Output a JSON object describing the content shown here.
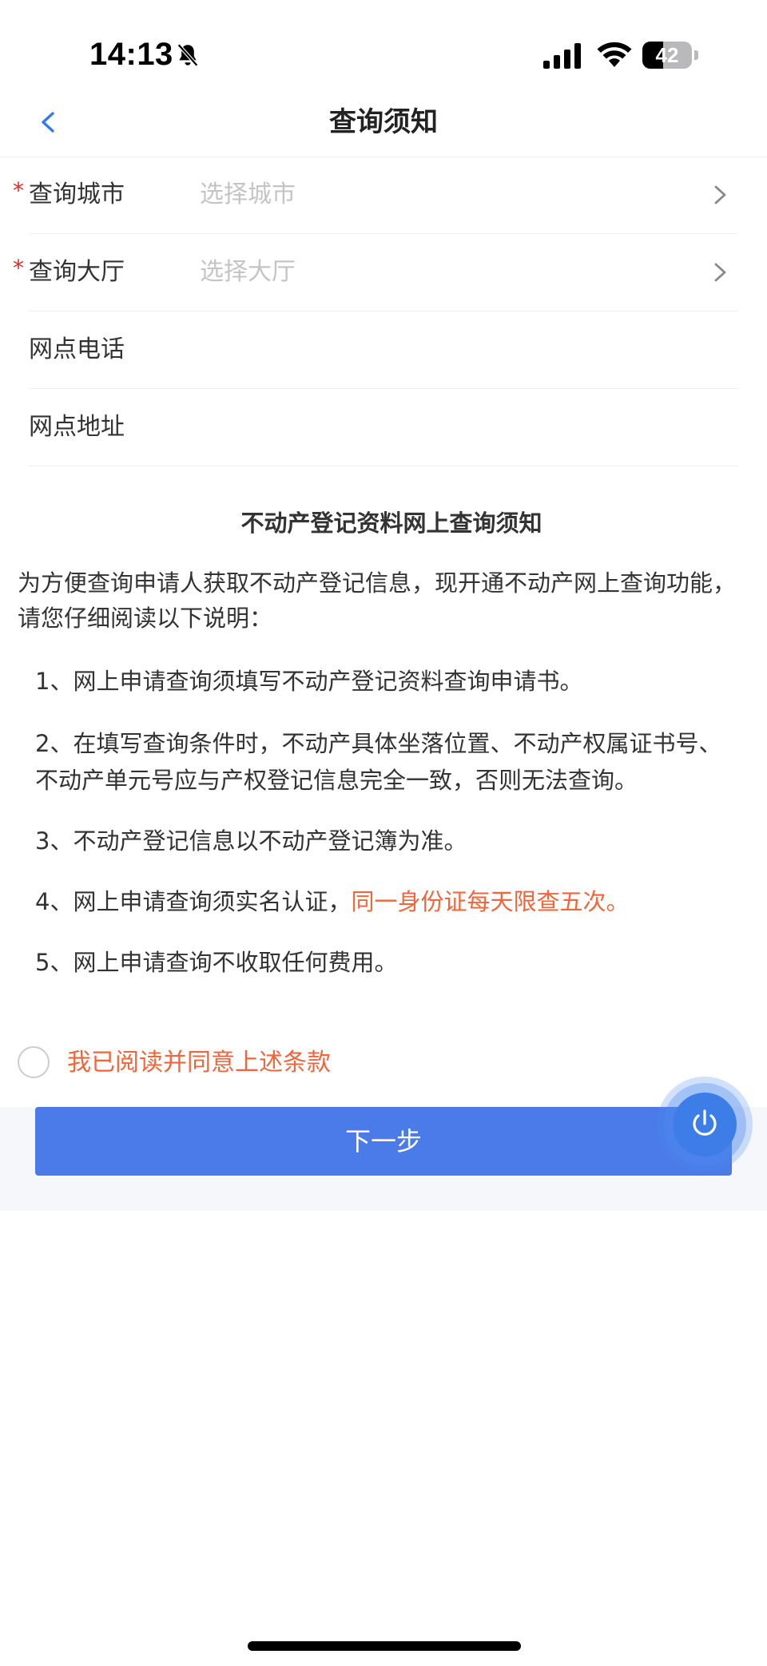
{
  "status_bar": {
    "time": "14:13",
    "battery_level": "42",
    "battery_fraction": 0.42,
    "icons": [
      "bell-slash-icon",
      "signal-icon",
      "wifi-icon",
      "battery-icon"
    ]
  },
  "nav": {
    "title": "查询须知",
    "back_icon": "chevron-left-icon"
  },
  "form": {
    "city": {
      "label": "查询城市",
      "placeholder": "选择城市",
      "required": true
    },
    "hall": {
      "label": "查询大厅",
      "placeholder": "选择大厅",
      "required": true
    },
    "phone": {
      "label": "网点电话",
      "value": ""
    },
    "address": {
      "label": "网点地址",
      "value": ""
    },
    "required_mark": "*"
  },
  "notice": {
    "title": "不动产登记资料网上查询须知",
    "intro": "为方便查询申请人获取不动产登记信息，现开通不动产网上查询功能，请您仔细阅读以下说明：",
    "items": [
      "1、网上申请查询须填写不动产登记资料查询申请书。",
      "2、在填写查询条件时，不动产具体坐落位置、不动产权属证书号、不动产单元号应与产权登记信息完全一致，否则无法查询。",
      "3、不动产登记信息以不动产登记簿为准。",
      "4、网上申请查询须实名认证，",
      "5、网上申请查询不收取任何费用。"
    ],
    "item4_highlight": "同一身份证每天限查五次。"
  },
  "agreement": {
    "label": "我已阅读并同意上述条款",
    "checked": false
  },
  "actions": {
    "next_label": "下一步"
  },
  "floating": {
    "icon": "power-icon"
  },
  "colors": {
    "primary": "#4a7be8",
    "highlight": "#f0663a",
    "required": "#e52a2a",
    "placeholder": "#c4c4c4",
    "back_icon": "#3478f6"
  }
}
